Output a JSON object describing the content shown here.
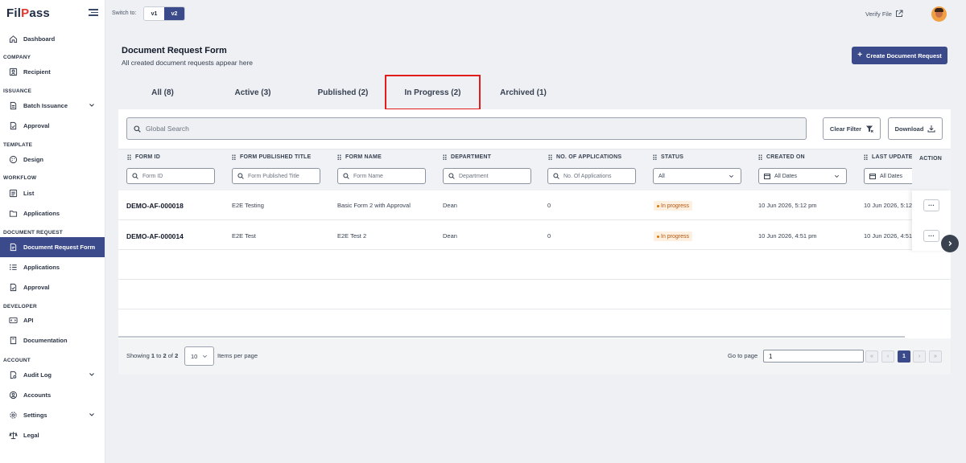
{
  "brand": {
    "name_part1": "Fil",
    "name_tick": "P",
    "name_part2": "ass"
  },
  "topbar": {
    "switch_label": "Switch to:",
    "versions": [
      "v1",
      "v2"
    ],
    "active_version": "v2",
    "verify_label": "Verify File"
  },
  "sidebar": {
    "sections": {
      "company": "COMPANY",
      "issuance": "ISSUANCE",
      "template": "TEMPLATE",
      "workflow": "WORKFLOW",
      "document_request": "DOCUMENT REQUEST",
      "developer": "DEVELOPER",
      "account": "ACCOUNT"
    },
    "items": {
      "dashboard": "Dashboard",
      "recipient": "Recipient",
      "batch_issuance": "Batch Issuance",
      "approval": "Approval",
      "design": "Design",
      "list": "List",
      "applications": "Applications",
      "document_request_form": "Document Request Form",
      "dr_applications": "Applications",
      "dr_approval": "Approval",
      "api": "API",
      "documentation": "Documentation",
      "audit_log": "Audit Log",
      "accounts": "Accounts",
      "settings": "Settings",
      "legal": "Legal"
    },
    "active": "Document Request Form"
  },
  "header": {
    "title": "Document Request Form",
    "subtitle": "All created document requests appear here",
    "create_button": "Create Document Request"
  },
  "tabs": [
    {
      "label": "All (8)"
    },
    {
      "label": "Active (3)"
    },
    {
      "label": "Published (2)"
    },
    {
      "label": "In Progress (2)",
      "selected": true
    },
    {
      "label": "Archived (1)"
    }
  ],
  "toolbar": {
    "search_placeholder": "Global Search",
    "clear_filter": "Clear Filter",
    "download": "Download"
  },
  "table": {
    "columns": [
      {
        "label": "FORM ID",
        "filter": "Form ID"
      },
      {
        "label": "FORM PUBLISHED TITLE",
        "filter": "Form Published Title"
      },
      {
        "label": "FORM NAME",
        "filter": "Form Name"
      },
      {
        "label": "DEPARTMENT",
        "filter": "Department"
      },
      {
        "label": "NO. OF APPLICATIONS",
        "filter": "No. Of Applications"
      },
      {
        "label": "STATUS",
        "filter": "All"
      },
      {
        "label": "CREATED ON",
        "filter": "All Dates"
      },
      {
        "label": "LAST UPDATE",
        "filter": "All Dates"
      }
    ],
    "action_label": "ACTION",
    "rows": [
      {
        "form_id": "DEMO-AF-000018",
        "title": "E2E Testing",
        "name": "Basic Form 2 with Approval",
        "department": "Dean",
        "applications": "0",
        "status": "In progress",
        "created": "10 Jun 2026, 5:12 pm",
        "updated": "10 Jun 2026, 5:12"
      },
      {
        "form_id": "DEMO-AF-000014",
        "title": "E2E Test",
        "name": "E2E Test 2",
        "department": "Dean",
        "applications": "0",
        "status": "In progress",
        "created": "10 Jun 2026, 4:51 pm",
        "updated": "10 Jun 2026, 4:51"
      }
    ],
    "more_label": "···"
  },
  "pagination": {
    "showing_prefix": "Showing",
    "from": "1",
    "to_word": "to",
    "to": "2",
    "of_word": "of",
    "total": "2",
    "per_page": "10",
    "per_page_label": "Items per page",
    "goto_label": "Go to page",
    "goto_value": "1",
    "current_page": "1",
    "first": "«",
    "prev": "‹",
    "next": "›",
    "last": "»"
  },
  "colors": {
    "accent": "#3b4a8a",
    "highlight": "#e21b1b",
    "status_bg": "#fdf0e1",
    "status_text": "#b45309"
  }
}
